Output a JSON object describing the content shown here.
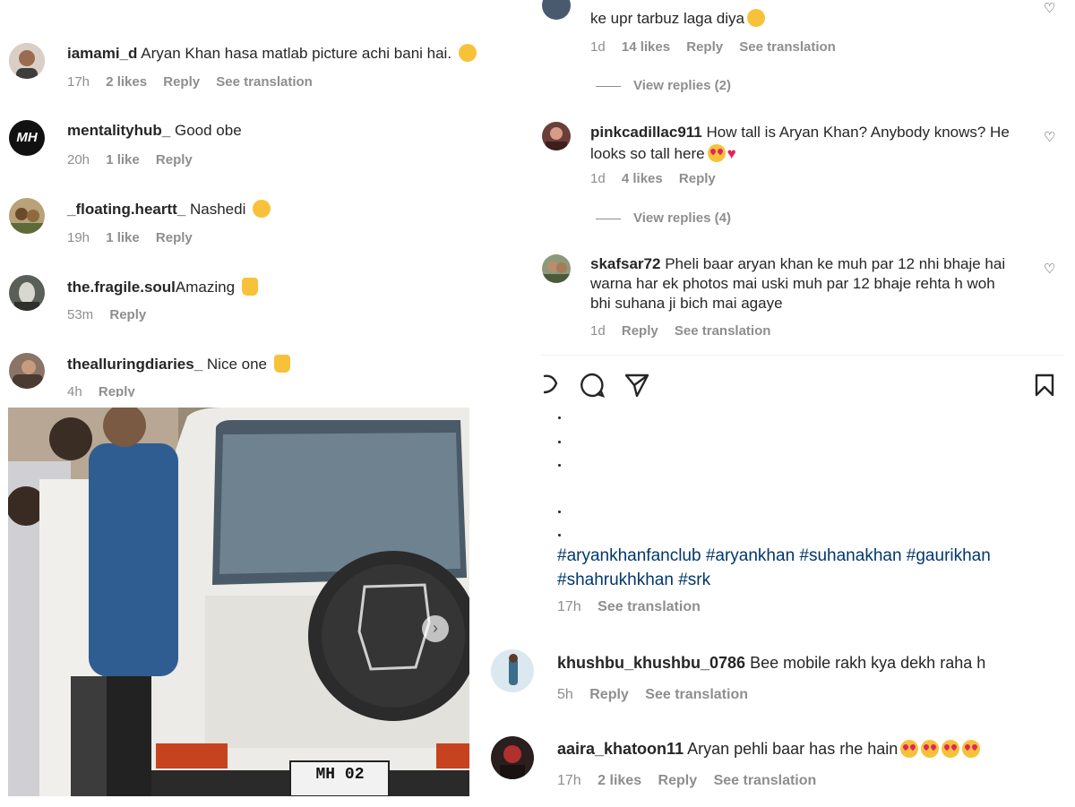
{
  "left_comments": [
    {
      "user": "iamami_d",
      "text": "Aryan Khan hasa matlab picture achi bani hai.",
      "time": "17h",
      "likes": "2 likes",
      "reply": "Reply",
      "translate": "See translation"
    },
    {
      "user": "mentalityhub_",
      "text": "Good obe",
      "time": "20h",
      "likes": "1 like",
      "reply": "Reply",
      "avatar_text": "MH"
    },
    {
      "user": "_floating.heartt_",
      "text": "Nashedi",
      "time": "19h",
      "likes": "1 like",
      "reply": "Reply"
    },
    {
      "user": "the.fragile.soul",
      "text": "Amazing",
      "time": "53m",
      "reply": "Reply"
    },
    {
      "user": "thealluringdiaries_",
      "text": "Nice one",
      "time": "4h",
      "reply": "Reply"
    }
  ],
  "right_top": {
    "partial_text": "ke upr tarbuz laga diya",
    "time": "1d",
    "likes": "14 likes",
    "reply": "Reply",
    "translate": "See translation",
    "view_replies": "View replies (2)"
  },
  "right_comments": [
    {
      "user": "pinkcadillac911",
      "text_line1": "How tall is Aryan Khan? Anybody knows? He",
      "text_line2": "looks so tall here",
      "time": "1d",
      "likes": "4 likes",
      "reply": "Reply",
      "view_replies": "View replies (4)"
    },
    {
      "user": "skafsar72",
      "text_line1": "Pheli baar aryan khan ke muh par 12 nhi bhaje hai",
      "text_line2": "warna har ek photos mai uski muh par 12 bhaje rehta h woh",
      "text_line3": "bhi suhana ji bich mai agaye",
      "time": "1d",
      "reply": "Reply",
      "translate": "See translation"
    }
  ],
  "caption": {
    "hashtags_line1": "#aryankhanfanclub #aryankhan #suhanakhan #gaurikhan",
    "hashtags_line2": "#shahrukhkhan #srk",
    "time": "17h",
    "translate": "See translation"
  },
  "bottom_comments": [
    {
      "user": "khushbu_khushbu_0786",
      "text": "Bee mobile rakh kya dekh raha h",
      "time": "5h",
      "reply": "Reply",
      "translate": "See translation"
    },
    {
      "user": "aaira_khatoon11",
      "text": "Aryan pehli baar has rhe hain",
      "time": "17h",
      "likes": "2 likes",
      "reply": "Reply",
      "translate": "See translation"
    }
  ],
  "photo": {
    "plate": "MH 02"
  },
  "colors": {
    "hashtag": "#00376b",
    "meta": "#8e8e8e",
    "text": "#262626"
  }
}
